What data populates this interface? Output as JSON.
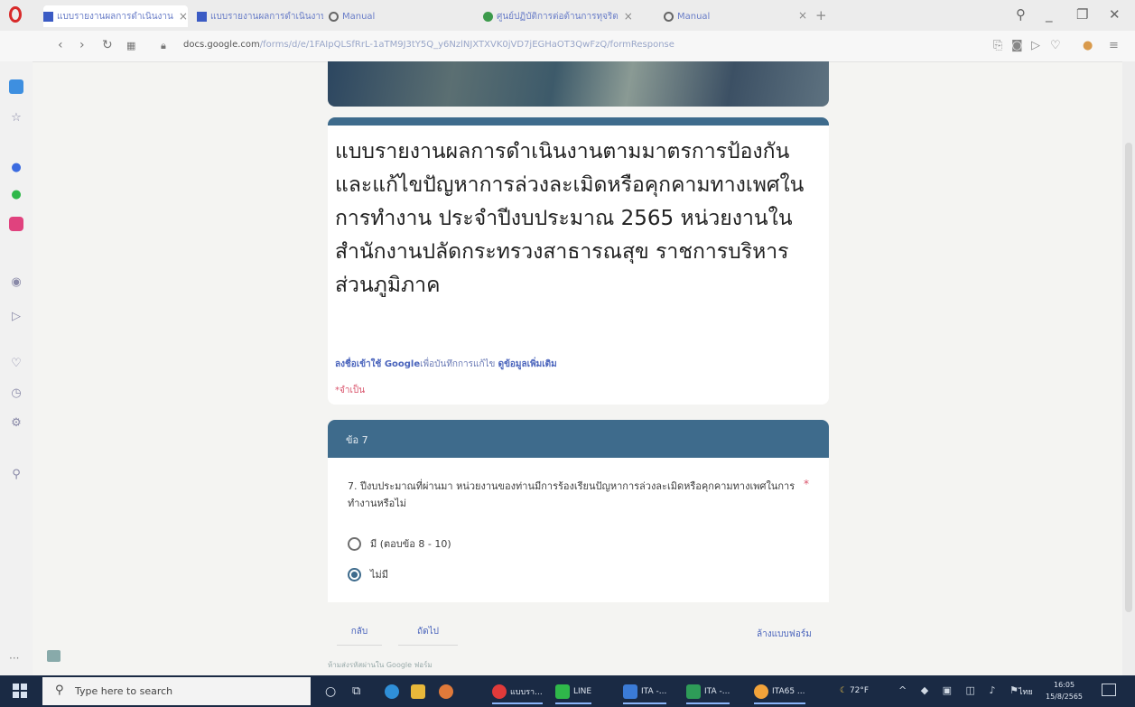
{
  "browser": {
    "tabs": [
      {
        "title": "แบบรายงานผลการดำเนินงาน",
        "icon": "form-doc-icon",
        "active": true
      },
      {
        "title": "แบบรายงานผลการดำเนินงาน",
        "icon": "form-doc-icon",
        "active": false
      },
      {
        "title": "Manual",
        "icon": "globe-icon",
        "active": false
      },
      {
        "title": "ศูนย์ปฏิบัติการต่อต้านการทุจริต",
        "icon": "gear-icon",
        "active": false
      },
      {
        "title": "Manual",
        "icon": "globe-icon",
        "active": false
      }
    ],
    "new_tab": "+",
    "url_domain": "docs.google.com",
    "url_path": "/forms/d/e/1FAIpQLSfRrL-1aTM9J3tY5Q_y6NzlNJXTXVK0jVD7jEGHaOT3QwFzQ/formResponse"
  },
  "form": {
    "title": "แบบรายงานผลการดำเนินงานตามมาตรการป้องกันและแก้ไขปัญหาการล่วงละเมิดหรือคุกคามทางเพศในการทำงาน ประจำปีงบประมาณ 2565 หน่วยงานในสำนักงานปลัดกระทรวงสาธารณสุข ราชการบริหารส่วนภูมิภาค",
    "signin_link": "ลงชื่อเข้าใช้ Google",
    "signin_text": "เพื่อบันทึกการแก้ไข",
    "learn_more": "ดูข้อมูลเพิ่มเติม",
    "required_note": "*จำเป็น",
    "section_title": "ข้อ 7",
    "question": "7. ปีงบประมาณที่ผ่านมา หน่วยงานของท่านมีการร้องเรียนปัญหาการล่วงละเมิดหรือคุกคามทางเพศในการทำงานหรือไม่",
    "question_required": "*",
    "options": [
      {
        "label": "มี (ตอบข้อ 8 - 10)",
        "selected": false
      },
      {
        "label": "ไม่มี",
        "selected": true
      }
    ],
    "back_button": "กลับ",
    "next_button": "ถัดไป",
    "clear_button": "ล้างแบบฟอร์ม",
    "footer_note": "ห้ามส่งรหัสผ่านใน Google ฟอร์ม"
  },
  "taskbar": {
    "search_placeholder": "Type here to search",
    "apps": [
      {
        "label": "แบบรา...",
        "color": "#e03a3a"
      },
      {
        "label": "LINE",
        "color": "#2fb84a"
      },
      {
        "label": "ITA -...",
        "color": "#3b7bd6"
      },
      {
        "label": "ITA -...",
        "color": "#2e9c58"
      },
      {
        "label": "ITA65 ...",
        "color": "#f2a33a"
      }
    ],
    "weather": "72°F",
    "language": "ไทย",
    "time": "16:05",
    "date": "15/8/2565"
  }
}
